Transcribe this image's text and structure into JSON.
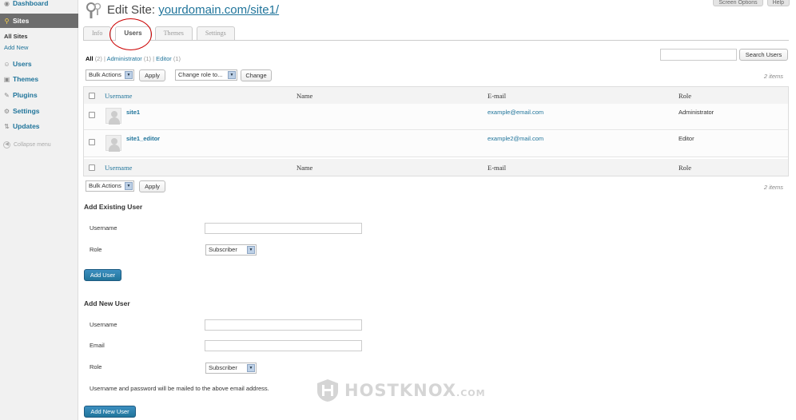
{
  "sidebar": {
    "items": [
      {
        "label": "Dashboard",
        "icon": "dashboard-icon"
      },
      {
        "label": "Sites",
        "icon": "sites-icon"
      },
      {
        "label": "Users",
        "icon": "users-icon"
      },
      {
        "label": "Themes",
        "icon": "themes-icon"
      },
      {
        "label": "Plugins",
        "icon": "plugins-icon"
      },
      {
        "label": "Settings",
        "icon": "settings-icon"
      },
      {
        "label": "Updates",
        "icon": "updates-icon"
      }
    ],
    "submenu": {
      "all_sites": "All Sites",
      "add_new": "Add New"
    },
    "collapse": "Collapse menu"
  },
  "top_buttons": {
    "screen_options": "Screen Options",
    "help": "Help"
  },
  "title": {
    "prefix": "Edit Site:",
    "link": "yourdomain.com/site1/"
  },
  "tabs": [
    "Info",
    "Users",
    "Themes",
    "Settings"
  ],
  "filters": {
    "all": "All",
    "all_count": "(2)",
    "admin": "Administrator",
    "admin_count": "(1)",
    "editor": "Editor",
    "editor_count": "(1)",
    "sep": "|"
  },
  "search_button": "Search Users",
  "bulk": {
    "select": "Bulk Actions",
    "apply": "Apply",
    "role_select": "Change role to...",
    "change": "Change"
  },
  "items_count": "2 items",
  "table": {
    "headers": [
      "Username",
      "Name",
      "E-mail",
      "Role"
    ],
    "rows": [
      {
        "username": "site1",
        "name": "",
        "email": "example@email.com",
        "role": "Administrator"
      },
      {
        "username": "site1_editor",
        "name": "",
        "email": "example2@mail.com",
        "role": "Editor"
      }
    ]
  },
  "add_existing": {
    "title": "Add Existing User",
    "username_label": "Username",
    "role_label": "Role",
    "role_value": "Subscriber",
    "button": "Add User"
  },
  "add_new": {
    "title": "Add New User",
    "username_label": "Username",
    "email_label": "Email",
    "role_label": "Role",
    "role_value": "Subscriber",
    "note": "Username and password will be mailed to the above email address.",
    "button": "Add New User"
  },
  "watermark": {
    "text": "HOSTKNOX",
    "suffix": ".COM"
  },
  "colors": {
    "link": "#21759b",
    "primary_button": "#21759b",
    "highlight_circle": "#cc0000",
    "sidebar_active": "#6d6d6d"
  }
}
